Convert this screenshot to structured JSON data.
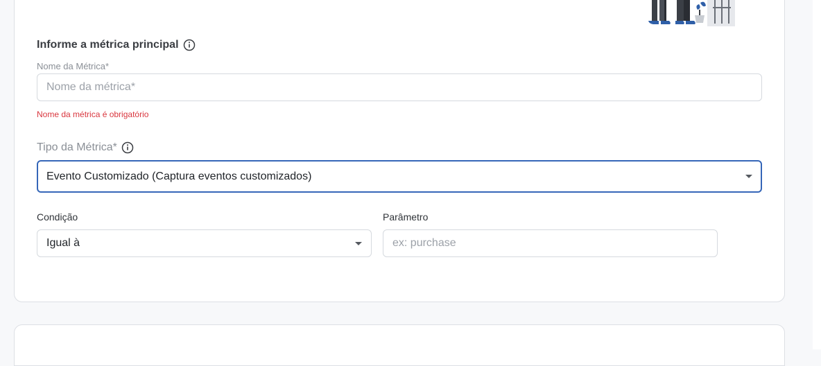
{
  "metric": {
    "title": "Informe a métrica principal",
    "name_label": "Nome da Métrica*",
    "name_placeholder": "Nome da métrica*",
    "name_value": "",
    "name_error": "Nome da métrica é obrigatório",
    "type_label": "Tipo da Métrica*",
    "type_value": "Evento Customizado (Captura eventos customizados)"
  },
  "condition": {
    "label": "Condição",
    "value": "Igual à"
  },
  "parameter": {
    "label": "Parâmetro",
    "placeholder": "ex: purchase",
    "value": ""
  },
  "icons": {
    "title_info": "info-circle-icon",
    "type_info": "info-circle-icon",
    "dropdown": "caret-down-icon"
  },
  "colors": {
    "error": "#d9363e",
    "focus_border": "#3566b8",
    "illustration_blue": "#2f5fa8"
  }
}
